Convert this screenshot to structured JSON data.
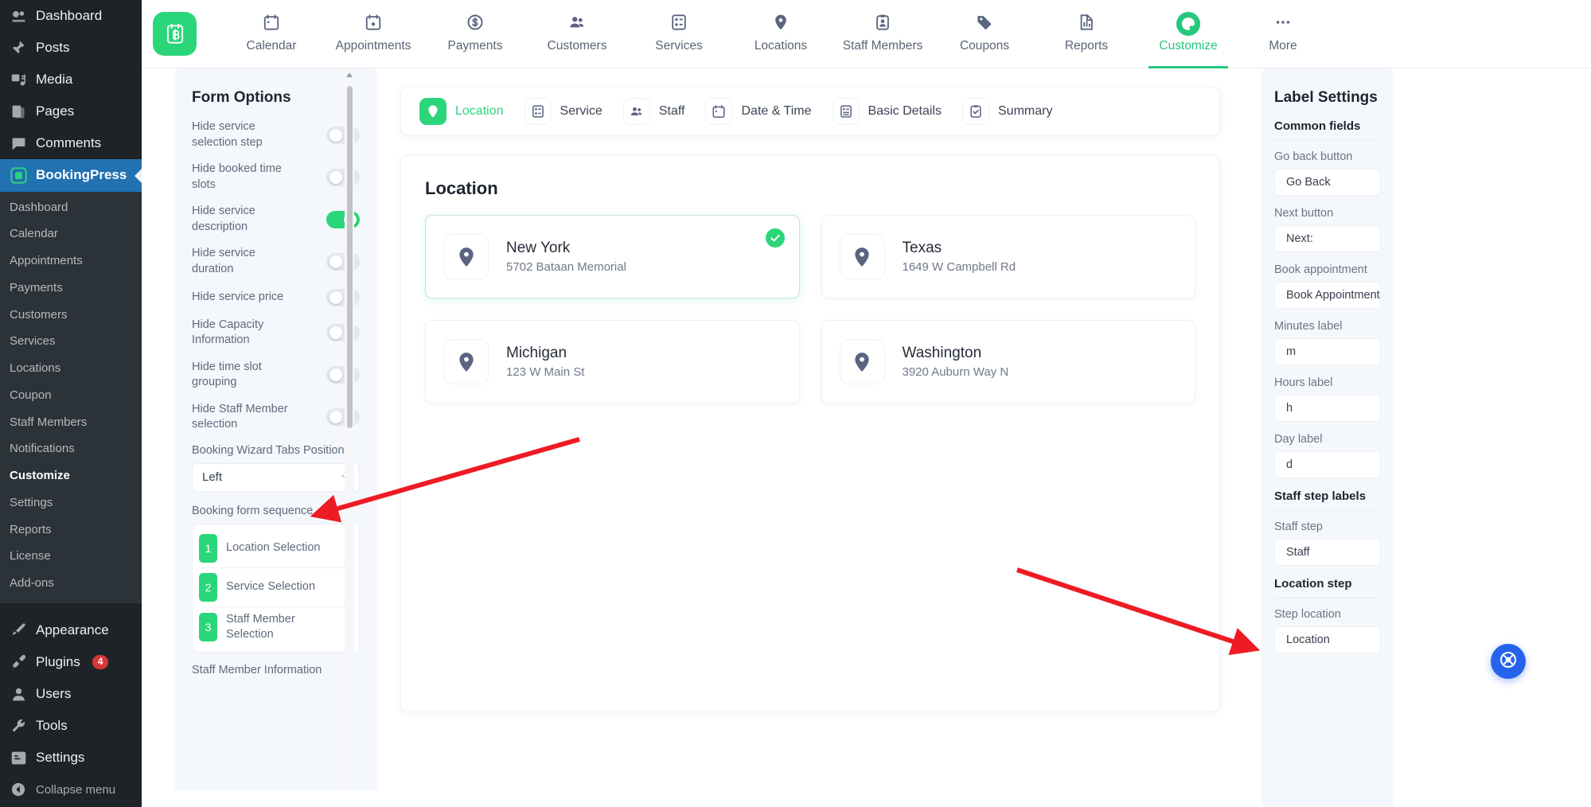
{
  "colors": {
    "brand_green": "#2bd67b",
    "wp_sidebar_bg": "#1d2327",
    "wp_active_blue": "#2271b1",
    "help_blue": "#2563eb",
    "arrow_red": "#ee1b24"
  },
  "wp_sidebar": {
    "items": [
      {
        "label": "Dashboard",
        "icon": "dashboard-icon"
      },
      {
        "label": "Posts",
        "icon": "pin-icon"
      },
      {
        "label": "Media",
        "icon": "media-icon"
      },
      {
        "label": "Pages",
        "icon": "pages-icon"
      },
      {
        "label": "Comments",
        "icon": "comments-icon"
      },
      {
        "label": "BookingPress",
        "icon": "bookingpress-icon",
        "active": true
      }
    ],
    "submenu": [
      "Dashboard",
      "Calendar",
      "Appointments",
      "Payments",
      "Customers",
      "Services",
      "Locations",
      "Coupon",
      "Staff Members",
      "Notifications",
      "Customize",
      "Settings",
      "Reports",
      "License",
      "Add-ons"
    ],
    "submenu_current": "Customize",
    "items_bottom": [
      {
        "label": "Appearance",
        "icon": "brush-icon"
      },
      {
        "label": "Plugins",
        "icon": "plug-icon",
        "badge": "4"
      },
      {
        "label": "Users",
        "icon": "user-icon"
      },
      {
        "label": "Tools",
        "icon": "wrench-icon"
      },
      {
        "label": "Settings",
        "icon": "settings-icon"
      }
    ],
    "collapse_label": "Collapse menu",
    "collapse_icon": "collapse-icon"
  },
  "topnav": {
    "logo_icon": "bookingpress-logo",
    "items": [
      {
        "label": "Calendar",
        "icon": "calendar-icon"
      },
      {
        "label": "Appointments",
        "icon": "appointments-icon"
      },
      {
        "label": "Payments",
        "icon": "dollar-icon"
      },
      {
        "label": "Customers",
        "icon": "customers-icon"
      },
      {
        "label": "Services",
        "icon": "services-icon"
      },
      {
        "label": "Locations",
        "icon": "location-pin-icon"
      },
      {
        "label": "Staff Members",
        "icon": "staff-icon"
      },
      {
        "label": "Coupons",
        "icon": "coupon-tag-icon"
      },
      {
        "label": "Reports",
        "icon": "reports-icon"
      },
      {
        "label": "Customize",
        "icon": "customize-palette-icon",
        "active": true
      },
      {
        "label": "More",
        "icon": "more-dots-icon"
      }
    ]
  },
  "form_options": {
    "title": "Form Options",
    "toggles": [
      {
        "label": "Hide service selection step",
        "on": false
      },
      {
        "label": "Hide booked time slots",
        "on": false
      },
      {
        "label": "Hide service description",
        "on": true
      },
      {
        "label": "Hide service duration",
        "on": false
      },
      {
        "label": "Hide service price",
        "on": false
      },
      {
        "label": "Hide Capacity Information",
        "on": false
      },
      {
        "label": "Hide time slot grouping",
        "on": false
      },
      {
        "label": "Hide Staff Member selection",
        "on": false
      }
    ],
    "tabs_position_label": "Booking Wizard Tabs Position",
    "tabs_position_value": "Left",
    "sequence_label": "Booking form sequence",
    "sequence": [
      {
        "num": "1",
        "name": "Location Selection"
      },
      {
        "num": "2",
        "name": "Service Selection"
      },
      {
        "num": "3",
        "name": "Staff Member Selection"
      }
    ],
    "next_label": "Staff Member Information"
  },
  "wizard": {
    "tabs": [
      {
        "label": "Location",
        "icon": "location-pin-icon",
        "active": true
      },
      {
        "label": "Service",
        "icon": "service-list-icon",
        "active": false
      },
      {
        "label": "Staff",
        "icon": "staff-group-icon",
        "active": false
      },
      {
        "label": "Date & Time",
        "icon": "calendar-icon",
        "active": false
      },
      {
        "label": "Basic Details",
        "icon": "details-form-icon",
        "active": false
      },
      {
        "label": "Summary",
        "icon": "summary-check-icon",
        "active": false
      }
    ]
  },
  "location_step": {
    "title": "Location",
    "cards": [
      {
        "name": "New York",
        "address": "5702 Bataan Memorial",
        "selected": true,
        "icon": "map-pin-icon"
      },
      {
        "name": "Texas",
        "address": "1649 W Campbell Rd",
        "selected": false,
        "icon": "map-pin-icon"
      },
      {
        "name": "Michigan",
        "address": "123 W Main St",
        "selected": false,
        "icon": "map-pin-icon"
      },
      {
        "name": "Washington",
        "address": "3920 Auburn Way N",
        "selected": false,
        "icon": "map-pin-icon"
      }
    ]
  },
  "label_settings": {
    "title": "Label Settings",
    "sections": [
      {
        "heading": "Common fields",
        "fields": [
          {
            "label": "Go back button",
            "value": "Go Back"
          },
          {
            "label": "Next button",
            "value": "Next:"
          },
          {
            "label": "Book appointment",
            "value": "Book Appointment"
          },
          {
            "label": "Minutes label",
            "value": "m"
          },
          {
            "label": "Hours label",
            "value": "h"
          },
          {
            "label": "Day label",
            "value": "d"
          }
        ]
      },
      {
        "heading": "Staff step labels",
        "fields": [
          {
            "label": "Staff step",
            "value": "Staff"
          }
        ]
      },
      {
        "heading": "Location step",
        "fields": [
          {
            "label": "Step location",
            "value": "Location"
          }
        ]
      }
    ]
  },
  "help_bubble": {
    "icon": "lifebuoy-icon"
  },
  "annotations": [
    {
      "name": "arrow-to-booking-form-sequence"
    },
    {
      "name": "arrow-to-step-location-field"
    }
  ]
}
